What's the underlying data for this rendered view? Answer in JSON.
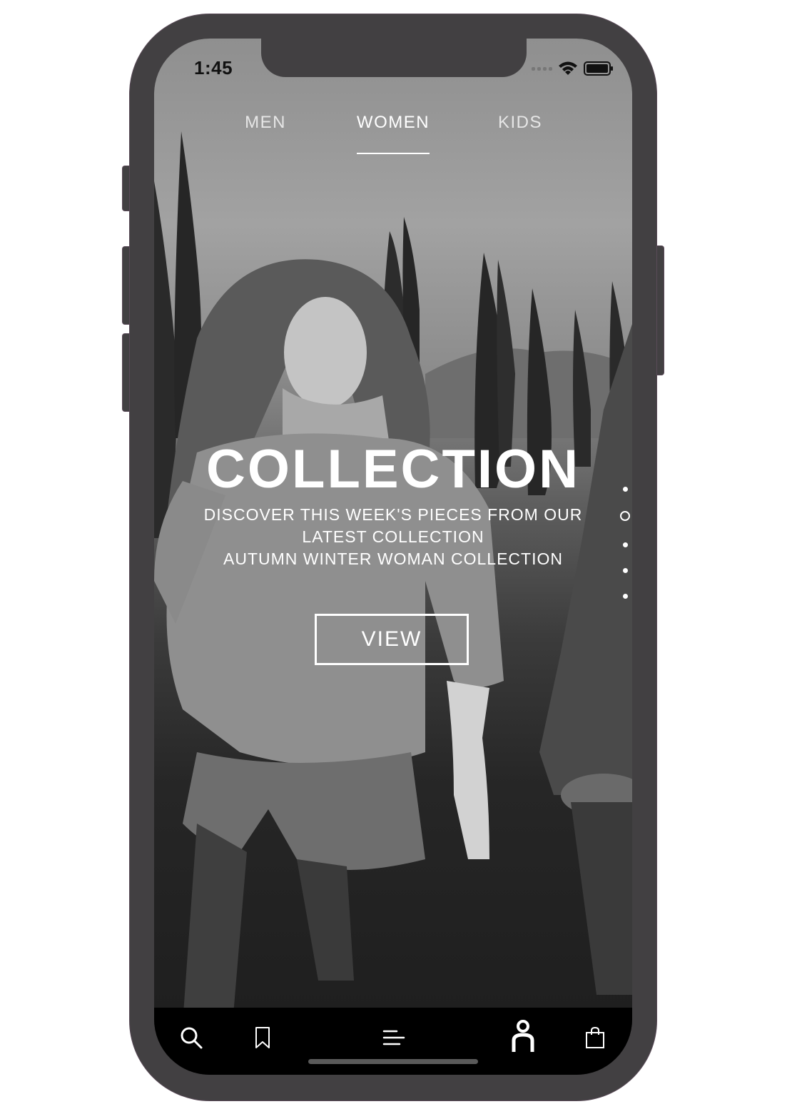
{
  "status_bar": {
    "time": "1:45",
    "icons": [
      "cellular-signal-icon",
      "wifi-icon",
      "battery-icon"
    ]
  },
  "top_tabs": {
    "items": [
      {
        "label": "MEN",
        "active": false
      },
      {
        "label": "WOMEN",
        "active": true
      },
      {
        "label": "KIDS",
        "active": false
      }
    ]
  },
  "hero": {
    "title": "COLLECTION",
    "subtitle_line1": "DISCOVER THIS WEEK'S PIECES FROM OUR",
    "subtitle_line2": "LATEST COLLECTION",
    "subtitle_line3": "AUTUMN WINTER WOMAN COLLECTION",
    "cta_label": "VIEW"
  },
  "carousel": {
    "total_pages": 5,
    "active_page": 2
  },
  "bottom_nav": {
    "items": [
      {
        "icon": "search-icon"
      },
      {
        "icon": "bookmark-icon"
      },
      {
        "icon": "menu-icon"
      },
      {
        "icon": "account-icon"
      },
      {
        "icon": "shopping-bag-icon"
      }
    ]
  },
  "colors": {
    "phone_frame": "#424042",
    "tab_bar": "#000000",
    "text": "#ffffff"
  }
}
